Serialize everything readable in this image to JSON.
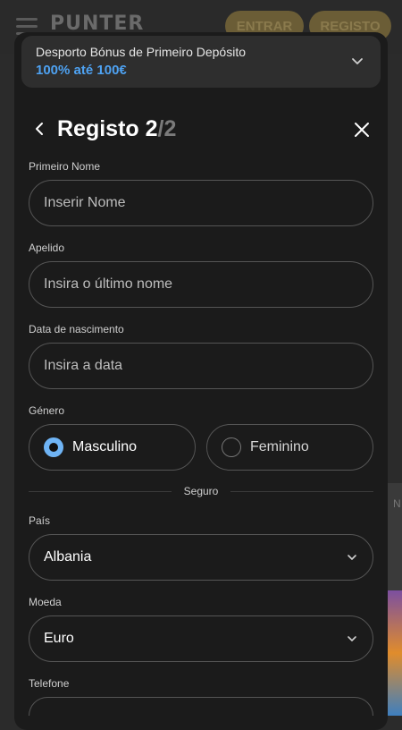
{
  "background": {
    "logo": "PUNTER",
    "login_label": "ENTRAR",
    "register_label": "REGISTO",
    "side_letter": "N"
  },
  "promo": {
    "title": "Desporto Bónus de Primeiro Depósito",
    "amount": "100% até 100€"
  },
  "header": {
    "title": "Registo 2",
    "step_total": "/2"
  },
  "form": {
    "first_name": {
      "label": "Primeiro Nome",
      "placeholder": "Inserir Nome"
    },
    "last_name": {
      "label": "Apelido",
      "placeholder": "Insira o último nome"
    },
    "birth_date": {
      "label": "Data de nascimento",
      "placeholder": "Insira a data"
    },
    "gender": {
      "label": "Género",
      "options": [
        "Masculino",
        "Feminino"
      ],
      "selected": "Masculino"
    },
    "section_divider": "Seguro",
    "country": {
      "label": "País",
      "value": "Albania"
    },
    "currency": {
      "label": "Moeda",
      "value": "Euro"
    },
    "phone": {
      "label": "Telefone"
    }
  },
  "colors": {
    "accent_blue": "#4ea2f2",
    "radio_selected": "#6fb4f5",
    "modal_bg": "#1b1b1b"
  }
}
